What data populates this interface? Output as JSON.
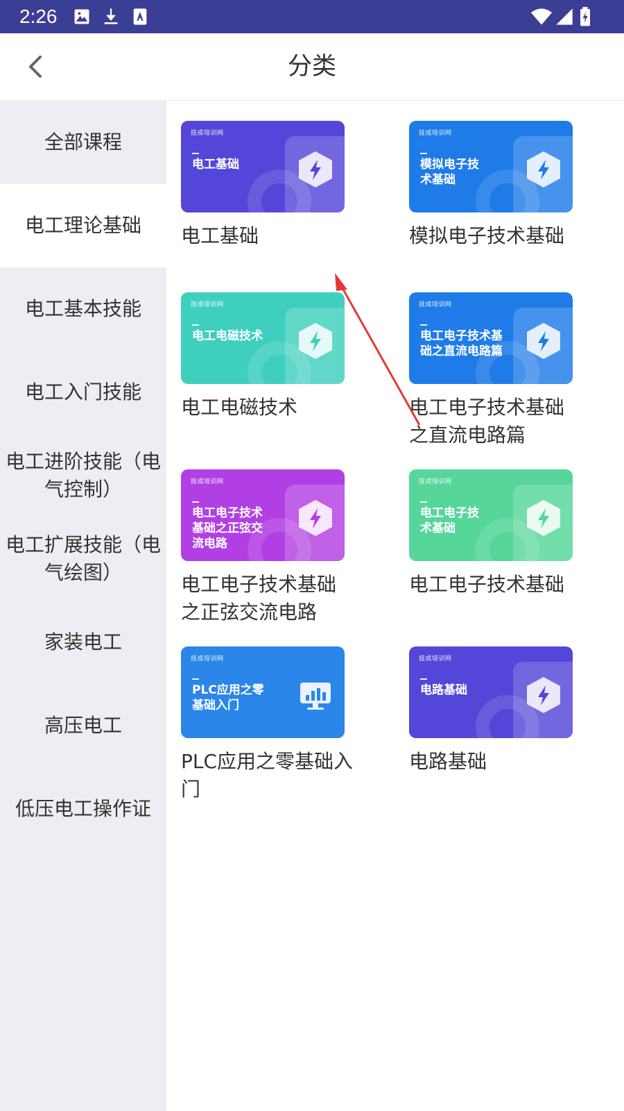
{
  "status_bar": {
    "time": "2:26",
    "left_icons": [
      "image-icon",
      "download-icon",
      "font-icon"
    ],
    "right_icons": [
      "wifi-icon",
      "signal-icon",
      "battery-icon"
    ]
  },
  "header": {
    "title": "分类",
    "back_icon": "chevron-left-icon"
  },
  "sidebar": {
    "items": [
      {
        "label": "全部课程",
        "active": false
      },
      {
        "label": "电工理论基础",
        "active": true
      },
      {
        "label": "电工基本技能",
        "active": false
      },
      {
        "label": "电工入门技能",
        "active": false
      },
      {
        "label": "电工进阶技能（电气控制）",
        "active": false
      },
      {
        "label": "电工扩展技能（电气绘图）",
        "active": false
      },
      {
        "label": "家装电工",
        "active": false
      },
      {
        "label": "高压电工",
        "active": false
      },
      {
        "label": "低压电工操作证",
        "active": false
      }
    ]
  },
  "courses": [
    {
      "cover_logo": "技成培训网",
      "cover_title": "电工基础",
      "title": "电工基础",
      "color": "#5446d8",
      "icon": "bolt-hexagon-icon"
    },
    {
      "cover_logo": "技成培训网",
      "cover_title": "模拟电子技术基础",
      "title": "模拟电子技术基础",
      "color": "#1e7be8",
      "icon": "bolt-hexagon-icon"
    },
    {
      "cover_logo": "技成培训网",
      "cover_title": "电工电磁技术",
      "title": "电工电磁技术",
      "color": "#3fcfbf",
      "icon": "bolt-hexagon-icon"
    },
    {
      "cover_logo": "技成培训网",
      "cover_title": "电工电子技术基础之直流电路篇",
      "title": "电工电子技术基础之直流电路篇",
      "color": "#1e7be8",
      "icon": "bolt-hexagon-icon"
    },
    {
      "cover_logo": "技成培训网",
      "cover_title": "电工电子技术基础之正弦交流电路",
      "title": "电工电子技术基础之正弦交流电路",
      "color": "#b23fe3",
      "icon": "bolt-hexagon-icon"
    },
    {
      "cover_logo": "技成培训网",
      "cover_title": "电工电子技术基础",
      "title": "电工电子技术基础",
      "color": "#56d69a",
      "icon": "bolt-hexagon-icon"
    },
    {
      "cover_logo": "技成培训网",
      "cover_title": "PLC应用之零基础入门",
      "title": "PLC应用之零基础入门",
      "color": "#2a86e9",
      "icon": "monitor-chart-icon"
    },
    {
      "cover_logo": "技成培训网",
      "cover_title": "电路基础",
      "title": "电路基础",
      "color": "#5446d8",
      "icon": "bolt-hexagon-icon"
    }
  ],
  "colors": {
    "status_bar": "#3a3f95",
    "sidebar_bg": "#eceef3",
    "annotation_arrow": "#e53935"
  }
}
